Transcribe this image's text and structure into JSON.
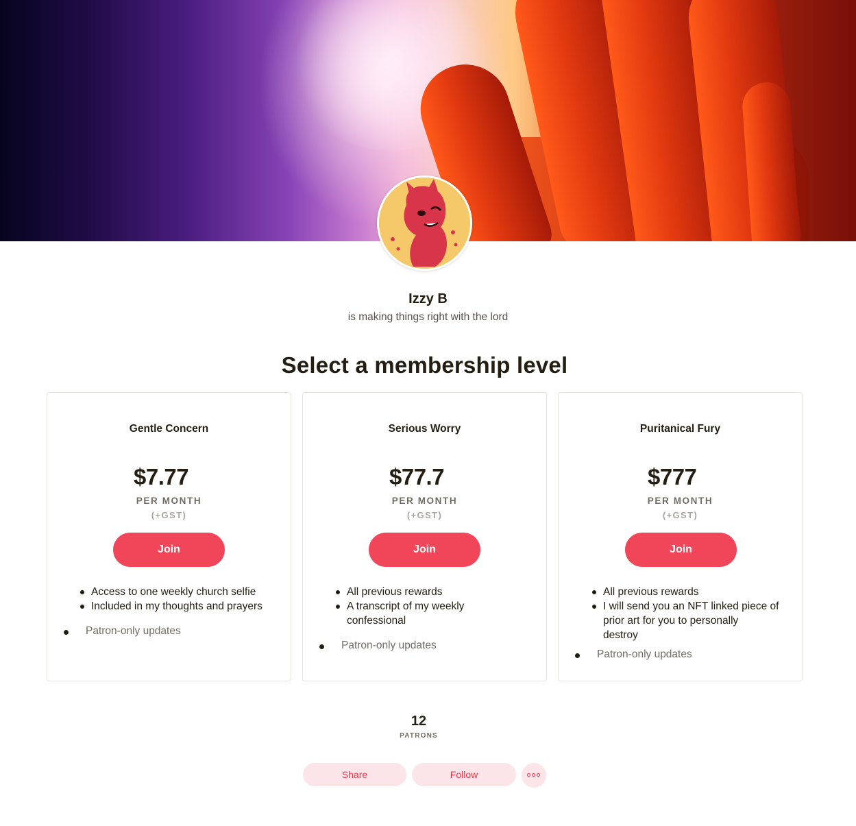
{
  "creator": {
    "name": "Izzy B",
    "tagline": "is making things right with the lord"
  },
  "section_title": "Select a membership level",
  "tiers": [
    {
      "name": "Gentle Concern",
      "price": "$7.77",
      "period": "PER MONTH",
      "tax": "(+GST)",
      "join_label": "Join",
      "benefits": [
        "Access to one weekly church selfie",
        "Included in my thoughts and prayers"
      ],
      "updates": "Patron-only updates"
    },
    {
      "name": "Serious Worry",
      "price": "$77.7",
      "period": "PER MONTH",
      "tax": "(+GST)",
      "join_label": "Join",
      "benefits": [
        "All previous rewards",
        "A transcript of my weekly",
        "confessional"
      ],
      "updates": "Patron-only updates"
    },
    {
      "name": "Puritanical Fury",
      "price": "$777",
      "period": "PER MONTH",
      "tax": "(+GST)",
      "join_label": "Join",
      "benefits": [
        "All previous rewards",
        "I will send you an NFT linked piece of",
        "prior art for you to personally",
        "destroy"
      ],
      "updates": "Patron-only updates"
    }
  ],
  "stats": {
    "patrons_count": "12",
    "patrons_label": "PATRONS"
  },
  "actions": {
    "share_label": "Share",
    "follow_label": "Follow",
    "more_icon": "more-horizontal-icon"
  },
  "colors": {
    "accent": "#f1465a",
    "pill_bg": "#fbe5e8",
    "pill_text": "#e6384c",
    "text": "#241e12",
    "muted": "#706c64"
  }
}
